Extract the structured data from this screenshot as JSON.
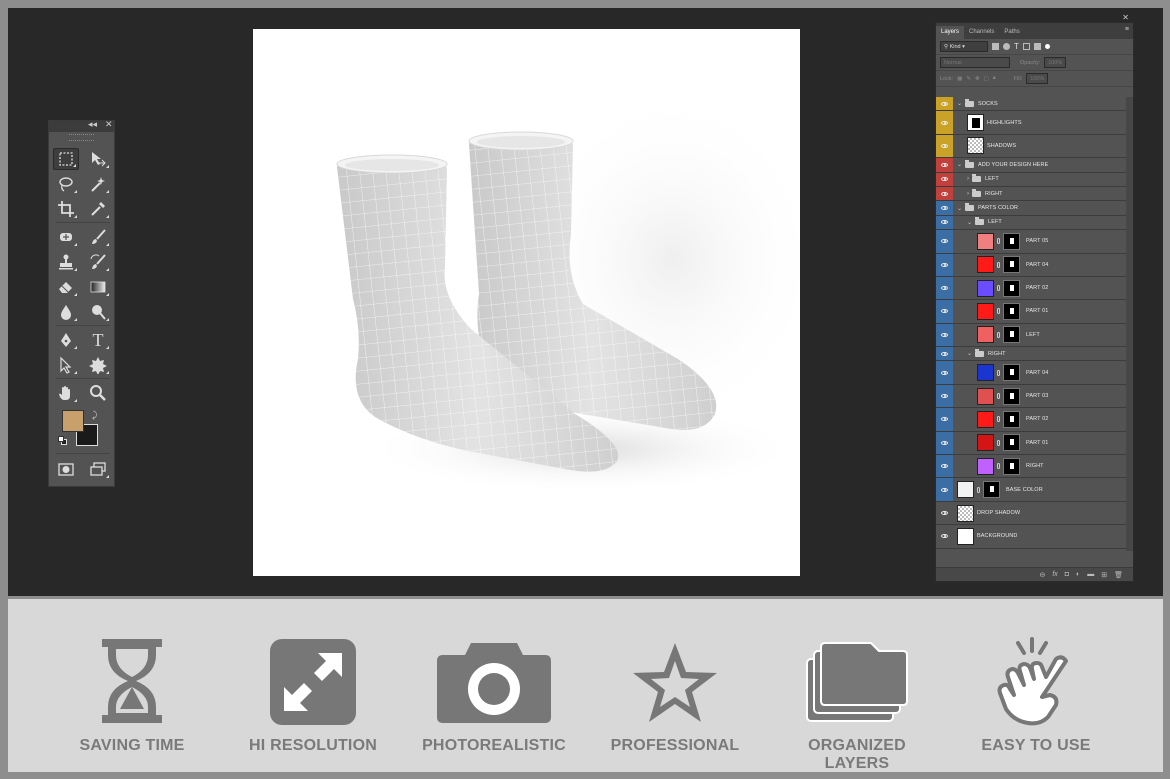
{
  "tools_panel": {
    "collapse_glyph": "◂◂",
    "close_glyph": "✕",
    "tools": [
      {
        "icon": "marquee-icon"
      },
      {
        "icon": "move-icon"
      },
      {
        "icon": "lasso-icon"
      },
      {
        "icon": "magic-wand-icon"
      },
      {
        "icon": "crop-icon"
      },
      {
        "icon": "eyedropper-icon"
      },
      {
        "icon": "healing-brush-icon"
      },
      {
        "icon": "brush-icon"
      },
      {
        "icon": "stamp-icon"
      },
      {
        "icon": "history-brush-icon"
      },
      {
        "icon": "eraser-icon"
      },
      {
        "icon": "gradient-icon"
      },
      {
        "icon": "blur-icon"
      },
      {
        "icon": "dodge-icon"
      },
      {
        "icon": "pen-icon"
      },
      {
        "icon": "type-icon"
      },
      {
        "icon": "path-selection-icon"
      },
      {
        "icon": "shape-icon"
      },
      {
        "icon": "hand-icon"
      },
      {
        "icon": "zoom-icon"
      }
    ],
    "type_glyph": "T",
    "foreground_color": "#c8a06c",
    "background_color": "#1a1a1a"
  },
  "layers_panel": {
    "close_glyph": "✕",
    "tabs": [
      {
        "label": "Layers"
      },
      {
        "label": "Channels"
      },
      {
        "label": "Paths"
      }
    ],
    "filter_kind": "Kind",
    "blend_mode": "Normal",
    "opacity_label": "Opacity:",
    "opacity_value": "100%",
    "lock_label": "Lock:",
    "fill_label": "Fill:",
    "fill_value": "100%",
    "layers": [
      {
        "name": "SOCKS",
        "kind": "group",
        "indent": 0,
        "tag": "#c9a227"
      },
      {
        "name": "HIGHLIGHTS",
        "kind": "smart",
        "indent": 1,
        "tag": "#c9a227"
      },
      {
        "name": "SHADOWS",
        "kind": "transparent",
        "indent": 1,
        "tag": "#c9a227"
      },
      {
        "name": "ADD YOUR DESIGN HERE",
        "kind": "group",
        "indent": 0,
        "tag": "#c0403c"
      },
      {
        "name": "LEFT",
        "kind": "group-closed",
        "indent": 1,
        "tag": "#c0403c"
      },
      {
        "name": "RIGHT",
        "kind": "group-closed",
        "indent": 1,
        "tag": "#c0403c"
      },
      {
        "name": "PARTS COLOR",
        "kind": "group",
        "indent": 0,
        "tag": "#3b6ea5"
      },
      {
        "name": "LEFT",
        "kind": "group",
        "indent": 1,
        "tag": "#3b6ea5"
      },
      {
        "name": "PART  05",
        "kind": "fill",
        "indent": 2,
        "color": "#f08080",
        "tag": "#3b6ea5"
      },
      {
        "name": "PART  04",
        "kind": "fill",
        "indent": 2,
        "color": "#ff1a1a",
        "tag": "#3b6ea5"
      },
      {
        "name": "PART  02",
        "kind": "fill",
        "indent": 2,
        "color": "#6b4cff",
        "tag": "#3b6ea5"
      },
      {
        "name": "PART  01",
        "kind": "fill",
        "indent": 2,
        "color": "#ff1a1a",
        "tag": "#3b6ea5"
      },
      {
        "name": "LEFT",
        "kind": "fill",
        "indent": 2,
        "color": "#f06060",
        "tag": "#3b6ea5"
      },
      {
        "name": "RIGHT",
        "kind": "group",
        "indent": 1,
        "tag": "#3b6ea5"
      },
      {
        "name": "PART  04",
        "kind": "fill",
        "indent": 2,
        "color": "#1a35d0",
        "tag": "#3b6ea5"
      },
      {
        "name": "PART  03",
        "kind": "fill",
        "indent": 2,
        "color": "#e05050",
        "tag": "#3b6ea5"
      },
      {
        "name": "PART  02",
        "kind": "fill",
        "indent": 2,
        "color": "#ff1a1a",
        "tag": "#3b6ea5"
      },
      {
        "name": "PART  01",
        "kind": "fill",
        "indent": 2,
        "color": "#d41515",
        "tag": "#3b6ea5"
      },
      {
        "name": "RIGHT",
        "kind": "fill",
        "indent": 2,
        "color": "#c060ff",
        "tag": "#3b6ea5"
      },
      {
        "name": "BASE COLOR",
        "kind": "fill",
        "indent": 0,
        "color": "#f2f2f2",
        "tag": "#3b6ea5"
      },
      {
        "name": "DROP SHADOW",
        "kind": "transparent",
        "indent": 0,
        "tag": ""
      },
      {
        "name": "BACKGROUND",
        "kind": "white",
        "indent": 0,
        "tag": ""
      }
    ],
    "footer_icons": [
      "link-icon",
      "fx-icon",
      "mask-icon",
      "adjustment-icon",
      "new-group-icon",
      "new-layer-icon",
      "delete-icon"
    ],
    "footer_glyphs": [
      "⊖",
      "fx",
      "◘",
      "◐",
      "▬",
      "⊞",
      "🗑"
    ]
  },
  "features": [
    {
      "label": "SAVING TIME",
      "icon": "hourglass-icon"
    },
    {
      "label": "HI RESOLUTION",
      "icon": "expand-icon"
    },
    {
      "label": "PHOTOREALISTIC",
      "icon": "camera-icon"
    },
    {
      "label": "PROFESSIONAL",
      "icon": "star-icon"
    },
    {
      "label": "ORGANIZED LAYERS",
      "icon": "layers-folder-icon"
    },
    {
      "label": "EASY TO USE",
      "icon": "hand-pointer-icon"
    }
  ],
  "colors": {
    "workspace": "#282828",
    "panel": "#535353",
    "feature_icon": "#777777"
  }
}
